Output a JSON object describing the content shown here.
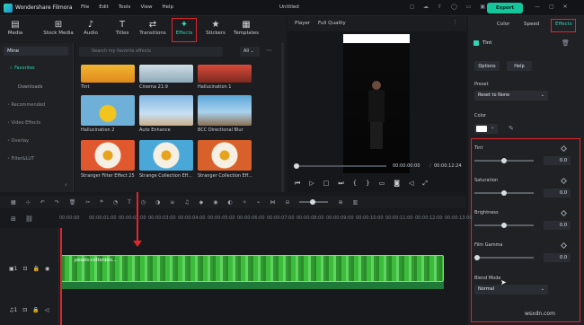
{
  "app": {
    "name": "Wondershare Filmora",
    "doc_title": "Untitled",
    "export_label": "Export"
  },
  "menu": [
    "File",
    "Edit",
    "Tools",
    "View",
    "Help"
  ],
  "toolbar": [
    {
      "label": "Media",
      "icon": "media-icon"
    },
    {
      "label": "Stock Media",
      "icon": "stock-media-icon"
    },
    {
      "label": "Audio",
      "icon": "audio-icon"
    },
    {
      "label": "Titles",
      "icon": "titles-icon"
    },
    {
      "label": "Transitions",
      "icon": "transitions-icon"
    },
    {
      "label": "Effects",
      "icon": "effects-icon",
      "active": true
    },
    {
      "label": "Stickers",
      "icon": "stickers-icon"
    },
    {
      "label": "Templates",
      "icon": "templates-icon"
    }
  ],
  "sidebar": {
    "mine": "Mine",
    "favorites": "Favorites",
    "downloads": "Downloads",
    "categories": [
      "Recommended",
      "Video Effects",
      "Overlay",
      "Filter&LUT"
    ]
  },
  "effects": {
    "search_placeholder": "Search my favorite effects",
    "filter": "All",
    "items": [
      {
        "label": "Tint"
      },
      {
        "label": "Cinema 21:9"
      },
      {
        "label": "Hallucination 1"
      },
      {
        "label": "Hallucination 2"
      },
      {
        "label": "Auto Enhance"
      },
      {
        "label": "BCC Directional Blur"
      },
      {
        "label": "Stranger Filter Effect 25"
      },
      {
        "label": "Strange Collection Eff..."
      },
      {
        "label": "Stranger Collection Eff..."
      }
    ]
  },
  "player": {
    "label": "Player",
    "quality": "Full Quality",
    "current_time": "00:00:00:00",
    "total_time": "00:00:12:24"
  },
  "panel": {
    "tabs": [
      "Color",
      "Speed",
      "Effects"
    ],
    "active_tab": "Effects",
    "effect_name": "Tint",
    "options_label": "Options",
    "help_label": "Help",
    "preset_label": "Preset",
    "preset_value": "Reset to None",
    "color_label": "Color",
    "color_value": "#ffffff",
    "sliders": [
      {
        "label": "Tint",
        "value": "0.0",
        "fraction": 0.5
      },
      {
        "label": "Saturation",
        "value": "0.0",
        "fraction": 0.5
      },
      {
        "label": "Brightness",
        "value": "0.0",
        "fraction": 0.5
      },
      {
        "label": "Film Gamma",
        "value": "0.0",
        "fraction": 0.0
      }
    ],
    "blend_label": "Blend Mode",
    "blend_value": "Normal"
  },
  "timeline": {
    "ruler": [
      "00:00:00",
      "00:00:01:00",
      "00:00:02:00",
      "00:00:03:00",
      "00:00:04:00",
      "00:00:05:00",
      "00:00:06:00",
      "00:00:07:00",
      "00:00:08:00",
      "00:00:09:00",
      "00:00:10:00",
      "00:00:11:00",
      "00:00:12:00",
      "00:00:13:00"
    ],
    "clip_label": "pexels-cottonbro...",
    "track_video": "1",
    "track_audio": "1"
  },
  "watermark": "wsxdn.com",
  "accent": "#14c79b",
  "highlight": "#e0262a"
}
